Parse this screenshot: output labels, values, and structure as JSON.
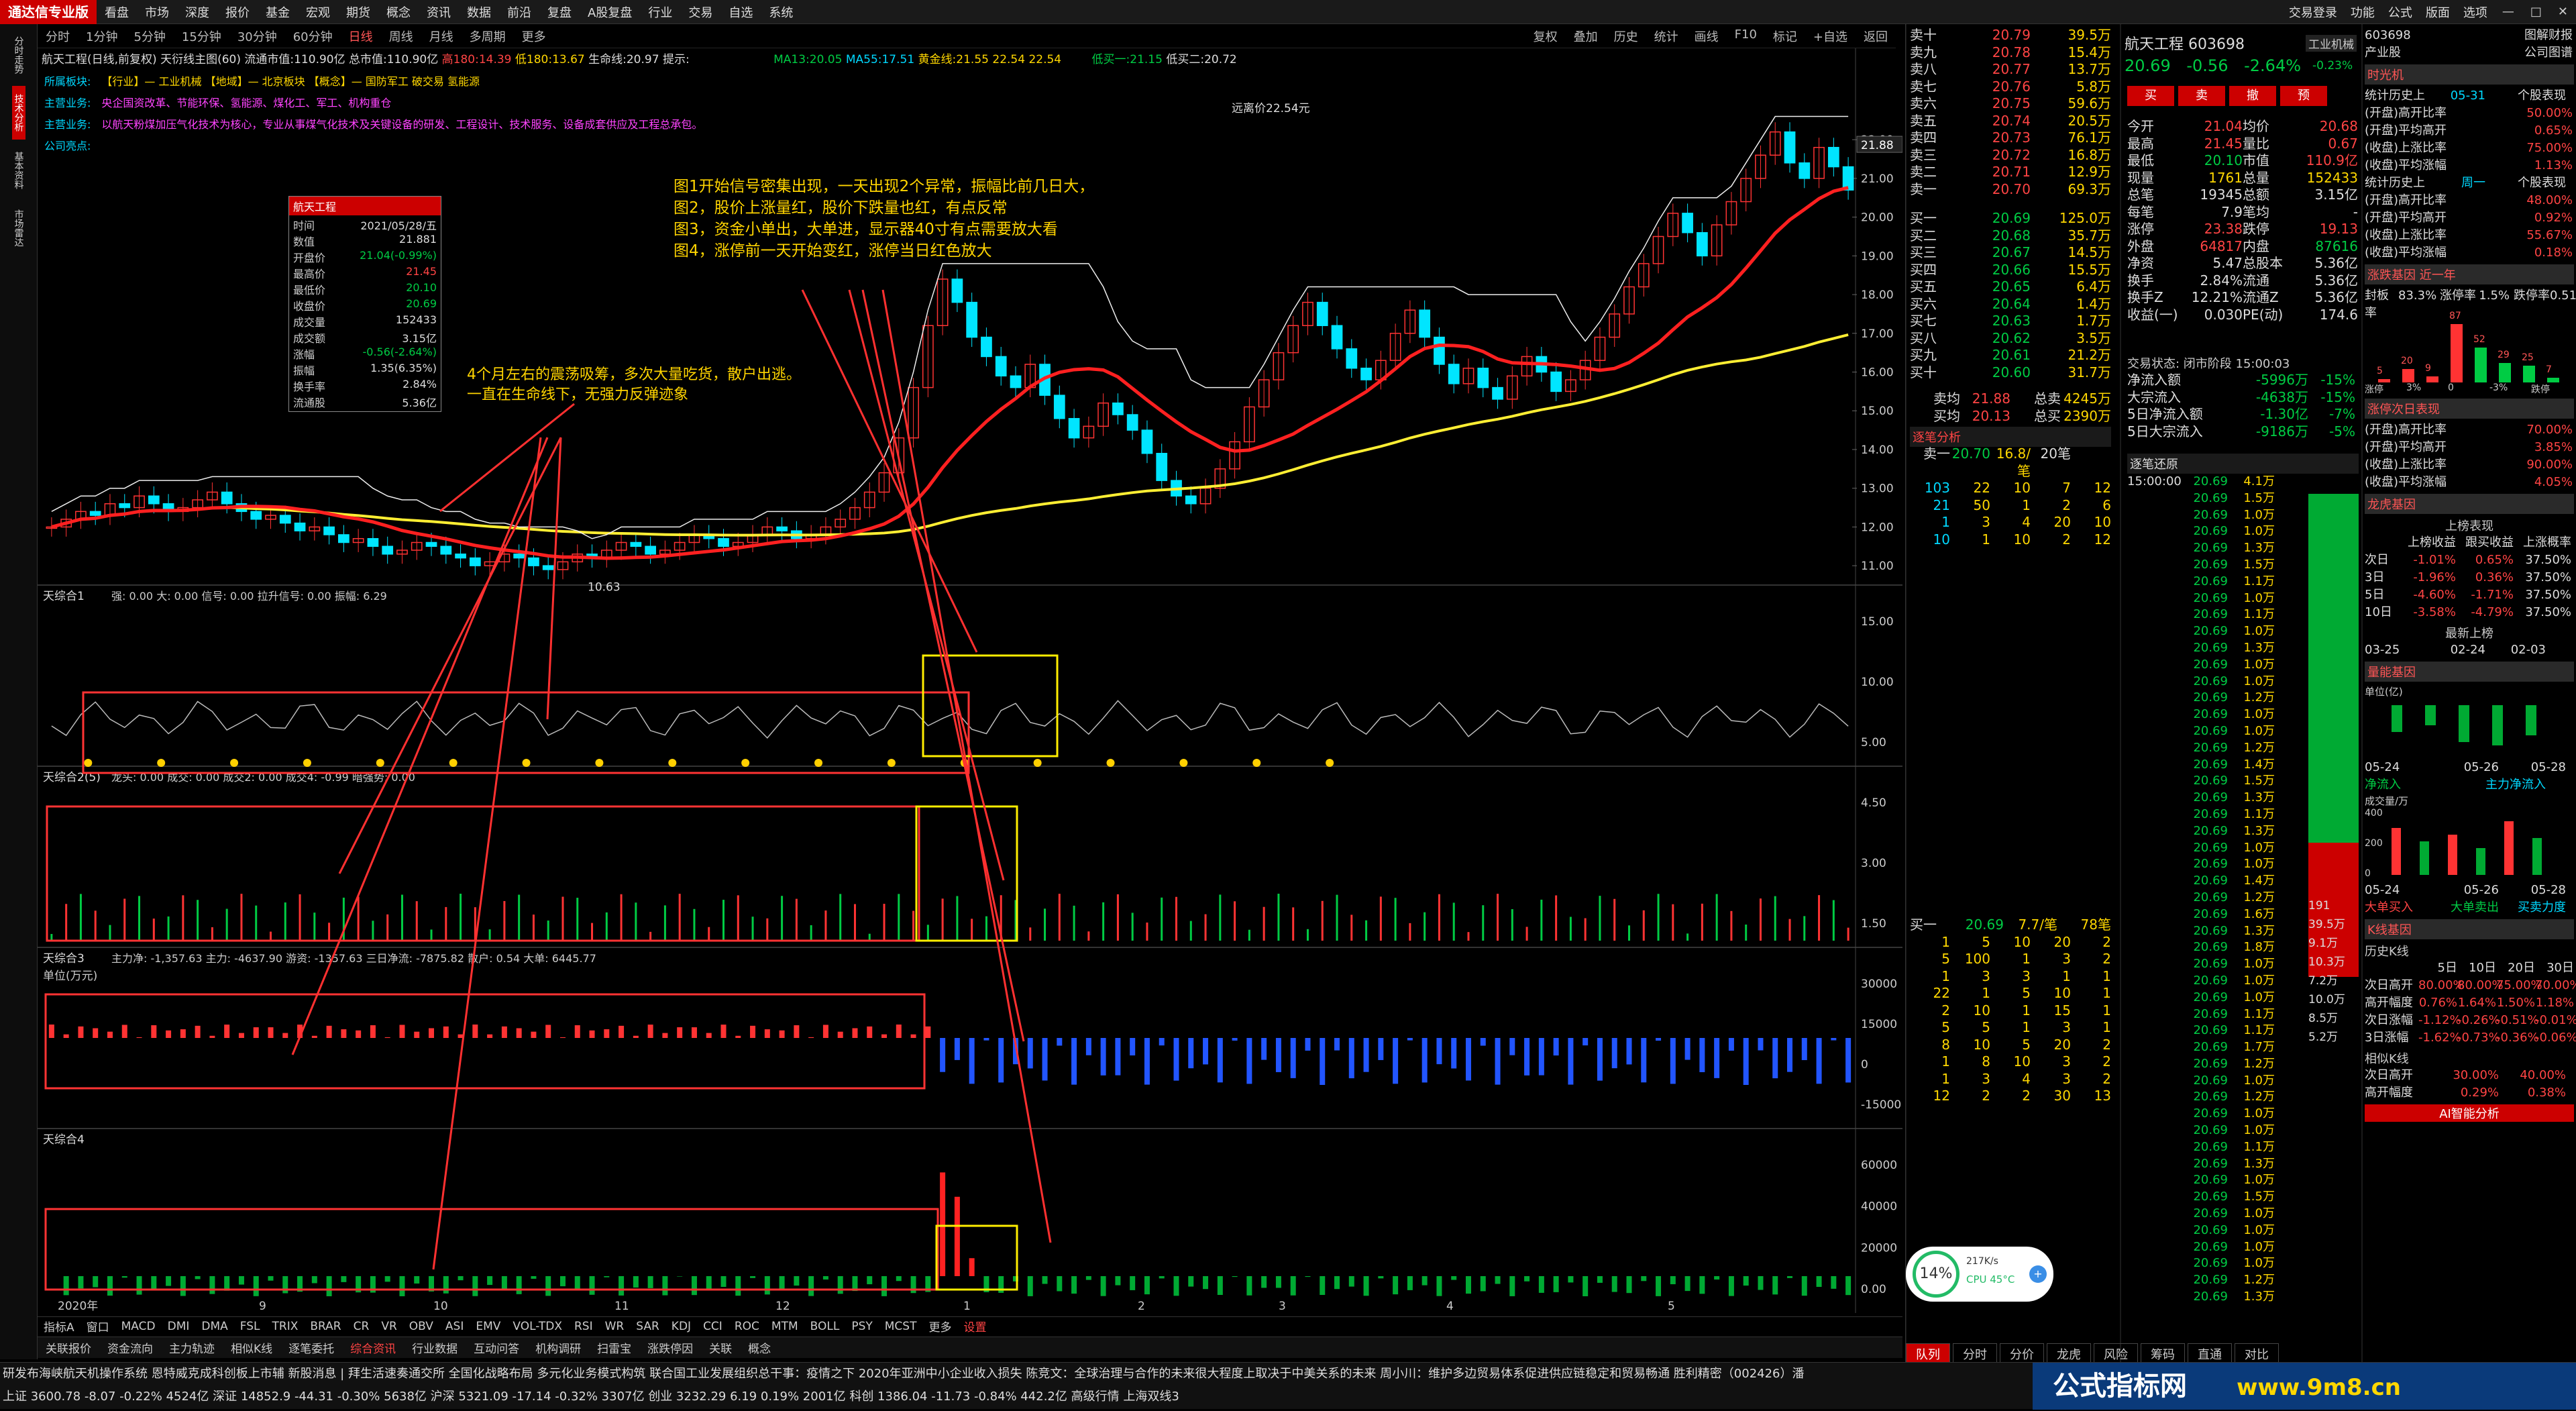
{
  "app": {
    "logo": "通达信专业版",
    "menu": [
      "看盘",
      "市场",
      "深度",
      "报价",
      "基金",
      "宏观",
      "期货",
      "概念",
      "资讯",
      "数据",
      "前沿",
      "复盘",
      "A股复盘",
      "行业",
      "交易",
      "自选",
      "系统"
    ],
    "right_menu": [
      "交易登录",
      "功能",
      "公式",
      "版面",
      "选项"
    ]
  },
  "periods": {
    "items": [
      "分时",
      "1分钟",
      "5分钟",
      "15分钟",
      "30分钟",
      "60分钟",
      "日线",
      "周线",
      "月线",
      "多周期",
      "更多"
    ],
    "selected": "日线"
  },
  "toolbar_right": [
    "复权",
    "叠加",
    "历史",
    "统计",
    "画线",
    "F10",
    "标记",
    "+自选",
    "返回"
  ],
  "chart_header": {
    "name": "航天工程(日线,前复权)",
    "formula": "天衍线主图(60)",
    "float_cap": "流通市值:110.90亿",
    "total_cap": "总市值:110.90亿",
    "hint": "提示:",
    "h180": "高180:14.39",
    "l180": "低180:13.67",
    "lifeline": "生命线:20.97",
    "ma13": "MA13:20.05",
    "ma55": "MA55:17.51",
    "gold": "黄金线:21.55",
    "vals": "22.54 22.54",
    "low1": "低买一:21.15",
    "low2": "低买二:20.72"
  },
  "info_lines": [
    {
      "label": "所属板块:",
      "text": "【行业】— 工业机械   【地域】— 北京板块   【概念】— 国防军工 破交易 氢能源"
    },
    {
      "label": "主营业务:",
      "text": "央企国资改革、节能环保、氢能源、煤化工、军工、机构重仓"
    },
    {
      "label": "主营业务:",
      "text": "以航天粉煤加压气化技术为核心，专业从事煤气化技术及关键设备的研发、工程设计、技术服务、设备成套供应及工程总承包。"
    },
    {
      "label": "公司亮点:",
      "text": ""
    }
  ],
  "annotation_big": [
    "图1开始信号密集出现，一天出现2个异常，振幅比前几日大，",
    "图2，股价上涨量红，股价下跌量也红，有点反常",
    "图3，资金小单出，大单进，显示器40寸有点需要放大看",
    "图4，涨停前一天开始变红，涨停当日红色放大"
  ],
  "annotation_left": [
    "4个月左右的震荡吸筹，多次大量吃货，散户出逃。",
    "一直在生命线下，无强力反弹迹象"
  ],
  "infobox": {
    "title": "航天工程",
    "rows": [
      [
        "时间",
        "2021/05/28/五"
      ],
      [
        "数值",
        "21.881"
      ],
      [
        "开盘价",
        "21.04(-0.99%)"
      ],
      [
        "最高价",
        "21.45"
      ],
      [
        "最低价",
        "20.10"
      ],
      [
        "收盘价",
        "20.69"
      ],
      [
        "成交量",
        "152433"
      ],
      [
        "成交额",
        "3.15亿"
      ],
      [
        "涨幅",
        "-0.56(-2.64%)"
      ],
      [
        "振幅",
        "1.35(6.35%)"
      ],
      [
        "换手率",
        "2.84%"
      ],
      [
        "流通股",
        "5.36亿"
      ]
    ]
  },
  "chart_data": [
    {
      "type": "candlestick",
      "title": "天衍线主图(60)",
      "yaxis_ticks": [
        "22.00",
        "21.00",
        "20.00",
        "19.00",
        "18.00",
        "17.00",
        "16.00",
        "15.00",
        "14.00",
        "13.00",
        "12.00",
        "11.00"
      ],
      "ylim": [
        10.5,
        22.8
      ],
      "xaxis_ticks": [
        "2020年",
        "9",
        "10",
        "11",
        "12",
        "1",
        "2",
        "3",
        "4",
        "5"
      ],
      "top_price_label": "21.88",
      "high_label": "22.54",
      "low_label": "10.63",
      "high_note": "远离价22.54元",
      "close": [
        12.0,
        12.2,
        12.4,
        12.3,
        12.6,
        12.5,
        12.8,
        12.6,
        12.4,
        12.5,
        12.7,
        12.9,
        12.6,
        12.4,
        12.2,
        12.3,
        12.1,
        11.9,
        12.0,
        11.8,
        11.6,
        11.7,
        11.5,
        11.3,
        11.4,
        11.6,
        11.5,
        11.3,
        11.2,
        11.0,
        11.1,
        11.3,
        11.2,
        11.0,
        10.9,
        11.1,
        11.3,
        11.2,
        11.4,
        11.6,
        11.5,
        11.3,
        11.4,
        11.6,
        11.8,
        11.7,
        11.5,
        11.6,
        11.8,
        12.0,
        11.9,
        11.7,
        11.8,
        12.0,
        12.2,
        12.5,
        12.9,
        13.4,
        14.3,
        15.6,
        17.2,
        18.4,
        17.8,
        16.9,
        16.4,
        15.9,
        15.6,
        16.2,
        15.4,
        14.8,
        14.3,
        14.6,
        15.2,
        14.9,
        14.5,
        13.9,
        13.2,
        12.8,
        12.6,
        13.0,
        13.5,
        14.2,
        15.1,
        15.8,
        16.5,
        17.2,
        17.8,
        17.2,
        16.6,
        16.1,
        15.8,
        16.3,
        17.0,
        17.6,
        16.9,
        16.2,
        15.7,
        16.1,
        15.6,
        15.3,
        15.9,
        16.4,
        16.0,
        15.5,
        15.8,
        16.3,
        16.9,
        17.5,
        18.2,
        18.8,
        19.5,
        20.1,
        19.6,
        19.0,
        19.8,
        20.4,
        21.0,
        21.6,
        22.2,
        21.4,
        21.0,
        21.8,
        21.3,
        20.7
      ]
    },
    {
      "type": "line",
      "title": "天综合1",
      "legend": "强: 0.00  大: 0.00  信号: 0.00  拉升信号: 0.00  振幅: 6.29",
      "yaxis_ticks": [
        "15.00",
        "10.00",
        "5.00"
      ]
    },
    {
      "type": "bar",
      "title": "天综合2(5)",
      "legend": "龙头: 0.00  成交: 0.00  成交2: 0.00  成交4: -0.99  暗强势: 0.00",
      "yaxis_ticks": [
        "4.50",
        "3.00",
        "1.50"
      ]
    },
    {
      "type": "bar",
      "title": "天综合3",
      "subtitle": "单位(万元)",
      "legend": "主力净: -1,357.63 主力: -4637.90 游资: -1357.63 三日净流: -7875.82 散户: 0.54 大单: 6445.77",
      "yaxis_ticks": [
        "30000",
        "15000",
        "0",
        "-15000"
      ]
    },
    {
      "type": "bar",
      "title": "天综合4",
      "yaxis_ticks": [
        "60000",
        "40000",
        "20000",
        "0.00"
      ]
    }
  ],
  "indicator_tabs": [
    "指标A",
    "窗口",
    "MACD",
    "DMI",
    "DMA",
    "FSL",
    "TRIX",
    "BRAR",
    "CR",
    "VR",
    "OBV",
    "ASI",
    "EMV",
    "VOL-TDX",
    "RSI",
    "WR",
    "SAR",
    "KDJ",
    "CCI",
    "ROC",
    "MTM",
    "BOLL",
    "PSY",
    "MCST",
    "更多",
    "设置"
  ],
  "bottom_tabs": [
    "关联报价",
    "资金流向",
    "主力轨迹",
    "相似K线",
    "逐笔委托",
    "综合资讯",
    "行业数据",
    "互动问答",
    "机构调研",
    "扫雷宝",
    "涨跌停因",
    "关联",
    "概念"
  ],
  "news": "研发布海峡航天机操作系统 恩特威克成科创板上市辅    新股消息 | 拜生活速奏通交所 全国化战略布局 多元化业务模式构筑    联合国工业发展组织总干事：疫情之下 2020年亚洲中小企业收入损失    陈竞文：全球治理与合作的未来很大程度上取决于中美关系的未来    周小川：维护多边贸易体系促进供应链稳定和贸易畅通    胜利精密（002426）潘",
  "status": "上证 3600.78 -8.07 -0.22% 4524亿  深证 14852.9 -44.31 -0.30% 5638亿  沪深 5321.09 -17.14 -0.32% 3307亿  创业 3232.29 6.19 0.19% 2001亿  科创 1386.04 -11.73 -0.84% 442.2亿    高级行情 上海双线3",
  "quote": {
    "name": "航天工程",
    "code": "603698",
    "sector": "工业机械",
    "price": "20.69",
    "change": "-0.56",
    "pct": "-2.64%",
    "sector_pct": "-0.23%",
    "asks": [
      [
        "卖十",
        "20.79",
        "39.5万"
      ],
      [
        "卖九",
        "20.78",
        "15.4万"
      ],
      [
        "卖八",
        "20.77",
        "13.7万"
      ],
      [
        "卖七",
        "20.76",
        "5.8万"
      ],
      [
        "卖六",
        "20.75",
        "59.6万"
      ],
      [
        "卖五",
        "20.74",
        "20.5万"
      ],
      [
        "卖四",
        "20.73",
        "76.1万"
      ],
      [
        "卖三",
        "20.72",
        "16.8万"
      ],
      [
        "卖二",
        "20.71",
        "12.9万"
      ],
      [
        "卖一",
        "20.70",
        "69.3万"
      ]
    ],
    "bids": [
      [
        "买一",
        "20.69",
        "125.0万"
      ],
      [
        "买二",
        "20.68",
        "35.7万"
      ],
      [
        "买三",
        "20.67",
        "14.5万"
      ],
      [
        "买四",
        "20.66",
        "15.5万"
      ],
      [
        "买五",
        "20.65",
        "6.4万"
      ],
      [
        "买六",
        "20.64",
        "1.4万"
      ],
      [
        "买七",
        "20.63",
        "1.7万"
      ],
      [
        "买八",
        "20.62",
        "3.5万"
      ],
      [
        "买九",
        "20.61",
        "21.2万"
      ],
      [
        "买十",
        "20.60",
        "31.7万"
      ]
    ],
    "avg": [
      [
        "卖均",
        "21.88",
        "总卖",
        "4245万"
      ],
      [
        "买均",
        "20.13",
        "总买",
        "2390万"
      ]
    ],
    "bigorder_title": "逐笔分析",
    "bigorder": [
      [
        "卖一",
        "20.70",
        "16.8/笔",
        "20笔"
      ],
      [
        "103",
        "22",
        "10",
        "7",
        "12"
      ],
      [
        "21",
        "50",
        "1",
        "2",
        "6"
      ],
      [
        "1",
        "3",
        "4",
        "20",
        "10"
      ],
      [
        "10",
        "1",
        "10",
        "2",
        "12"
      ]
    ],
    "bid_detail_title": "买一",
    "bid_detail_head": [
      "20.69",
      "7.7/笔",
      "78笔"
    ],
    "bid_detail": [
      [
        "1",
        "5",
        "10",
        "20",
        "2"
      ],
      [
        "5",
        "100",
        "1",
        "3",
        "2"
      ],
      [
        "1",
        "3",
        "3",
        "1",
        "1"
      ],
      [
        "22",
        "1",
        "5",
        "10",
        "1"
      ],
      [
        "2",
        "10",
        "1",
        "15",
        "1"
      ],
      [
        "5",
        "5",
        "1",
        "3",
        "1"
      ],
      [
        "8",
        "10",
        "5",
        "20",
        "2"
      ],
      [
        "1",
        "8",
        "10",
        "3",
        "2"
      ],
      [
        "1",
        "3",
        "4",
        "3",
        "2"
      ],
      [
        "12",
        "2",
        "2",
        "30",
        "13"
      ]
    ],
    "stats": [
      [
        "今开",
        "21.04",
        "均价",
        "20.68"
      ],
      [
        "最高",
        "21.45",
        "量比",
        "0.67"
      ],
      [
        "最低",
        "20.10",
        "市值",
        "110.9亿"
      ],
      [
        "现量",
        "1761",
        "总量",
        "152433"
      ],
      [
        "总笔",
        "19345",
        "总额",
        "3.15亿"
      ],
      [
        "每笔",
        "7.9",
        "笔均",
        "-"
      ],
      [
        "涨停",
        "23.38",
        "跌停",
        "19.13"
      ],
      [
        "外盘",
        "64817",
        "内盘",
        "87616"
      ],
      [
        "净资",
        "5.47",
        "总股本",
        "5.36亿"
      ],
      [
        "换手",
        "2.84%",
        "流通",
        "5.36亿"
      ],
      [
        "换手Z",
        "12.21%",
        "流通Z",
        "5.36亿"
      ],
      [
        "收益(一)",
        "0.030",
        "PE(动)",
        "174.6"
      ]
    ],
    "trade_state": "交易状态: 闭市阶段 15:00:03",
    "flows": [
      [
        "净流入额",
        "-5996万",
        "-15%"
      ],
      [
        "大宗流入",
        "-4638万",
        "-15%"
      ],
      [
        "5日净流入额",
        "-1.30亿",
        "-7%"
      ],
      [
        "5日大宗流入",
        "-9186万",
        "-5%"
      ]
    ],
    "ticks_title": "逐笔还原",
    "ticks_time": "15:00:00",
    "tick_price": "20.69",
    "tick_qty": [
      "4.1万",
      "1.5万",
      "1.0万",
      "1.0万",
      "1.3万",
      "1.5万",
      "1.1万",
      "1.0万",
      "1.1万",
      "1.0万",
      "1.3万",
      "1.0万",
      "1.0万",
      "1.2万",
      "1.0万",
      "1.0万",
      "1.2万",
      "1.4万",
      "1.5万",
      "1.3万",
      "1.1万",
      "1.3万",
      "1.0万",
      "1.0万",
      "1.4万",
      "1.2万",
      "1.6万",
      "1.3万",
      "1.8万",
      "1.0万",
      "1.0万",
      "1.0万",
      "1.1万",
      "1.1万",
      "1.7万",
      "1.2万",
      "1.0万",
      "1.2万",
      "1.0万",
      "1.0万",
      "1.1万",
      "1.3万",
      "1.0万",
      "1.5万",
      "1.0万",
      "1.0万",
      "1.0万",
      "1.0万",
      "1.2万",
      "1.3万"
    ],
    "side_vals": [
      "191",
      "39.5万",
      "9.1万",
      "10.3万",
      "7.2万",
      "10.0万",
      "8.5万",
      "5.2万"
    ],
    "right_tabs": [
      "队列",
      "分时",
      "分价",
      "龙虎",
      "风险",
      "筹码",
      "直通",
      "对比"
    ]
  },
  "far_right": {
    "code": "603698",
    "name_hint": "图解财报",
    "industry": "产业股",
    "company": "公司图谱",
    "guang_title": "时光机",
    "hist1_title": "统计历史上",
    "hist1_date": "05-31",
    "hist1_suffix": "个股表现",
    "hist1": [
      [
        "(开盘)高开比率",
        "50.00%"
      ],
      [
        "(开盘)平均高开",
        "0.65%"
      ],
      [
        "(收盘)上涨比率",
        "75.00%"
      ],
      [
        "(收盘)平均涨幅",
        "1.13%"
      ]
    ],
    "hist2_title": "统计历史上",
    "hist2_mid": "周一",
    "hist2_suffix": "个股表现",
    "hist2": [
      [
        "(开盘)高开比率",
        "48.00%"
      ],
      [
        "(开盘)平均高开",
        "0.92%"
      ],
      [
        "(收盘)上涨比率",
        "55.67%"
      ],
      [
        "(收盘)平均涨幅",
        "0.18%"
      ]
    ],
    "gene_title": "涨跌基因",
    "gene_sub": "近一年",
    "gene_head": [
      "封板率",
      "83.3%",
      "涨停率",
      "1.5%",
      "跌停率",
      "0.51"
    ],
    "gene_bars": [
      "5",
      "20",
      "9",
      "87",
      "52",
      "29",
      "25",
      "7"
    ],
    "gene_x": [
      "涨停",
      "3%",
      "0",
      "-3%",
      "跌停"
    ],
    "next_title": "涨停次日表现",
    "next": [
      [
        "(开盘)高开比率",
        "70.00%"
      ],
      [
        "(开盘)平均高开",
        "3.85%"
      ],
      [
        "(收盘)上涨比率",
        "90.00%"
      ],
      [
        "(收盘)平均涨幅",
        "4.05%"
      ]
    ],
    "lhb_title": "龙虎基因",
    "lhb_sub": "上榜表现",
    "lhb_head": [
      "",
      "上榜收益",
      "跟买收益",
      "上涨概率"
    ],
    "lhb": [
      [
        "次日",
        "-1.01%",
        "0.65%",
        "37.50%"
      ],
      [
        "3日",
        "-1.96%",
        "0.36%",
        "37.50%"
      ],
      [
        "5日",
        "-4.60%",
        "-1.71%",
        "37.50%"
      ],
      [
        "10日",
        "-3.58%",
        "-4.79%",
        "37.50%"
      ]
    ],
    "latest_title": "最新上榜",
    "latest_dates": [
      "03-25",
      "02-24",
      "02-03"
    ],
    "vol_title": "量能基因",
    "vol_unit": "单位(亿)",
    "vol_dates": [
      "05-24",
      "05-26",
      "05-28"
    ],
    "vol_legend": [
      "净流入",
      "主力净流入"
    ],
    "turn_title": "成交量/万",
    "turn_ticks": [
      "400",
      "200",
      "0"
    ],
    "turn_dates": [
      "05-24",
      "05-26",
      "05-28"
    ],
    "turn_legend": [
      "大单买入",
      "大单卖出",
      "买卖力度"
    ],
    "k_title": "K线基因",
    "k_sub": "历史K线",
    "k_head": [
      "",
      "5日",
      "10日",
      "20日",
      "30日"
    ],
    "k": [
      [
        "次日高开",
        "80.00%",
        "80.00%",
        "75.00%",
        "70.00%"
      ],
      [
        "高开幅度",
        "0.76%",
        "1.64%",
        "1.50%",
        "1.18%"
      ],
      [
        "次日涨幅",
        "-1.12%",
        "-0.26%",
        "-0.51%",
        "-0.01%"
      ],
      [
        "3日涨幅",
        "-1.62%",
        "-0.73%",
        "-0.36%",
        "-0.06%"
      ]
    ],
    "similar_title": "相似K线",
    "similar": [
      [
        "次日高开",
        "30.00%",
        "40.00%"
      ],
      [
        "高开幅度",
        "0.29%",
        "0.38%"
      ]
    ],
    "ai": "AI智能分析"
  },
  "perf_widget": {
    "pct": "14",
    "net": "217K/s",
    "cpu": "CPU 45°C"
  },
  "watermark": {
    "text": "公式指标网",
    "url": "www.9m8.cn"
  }
}
